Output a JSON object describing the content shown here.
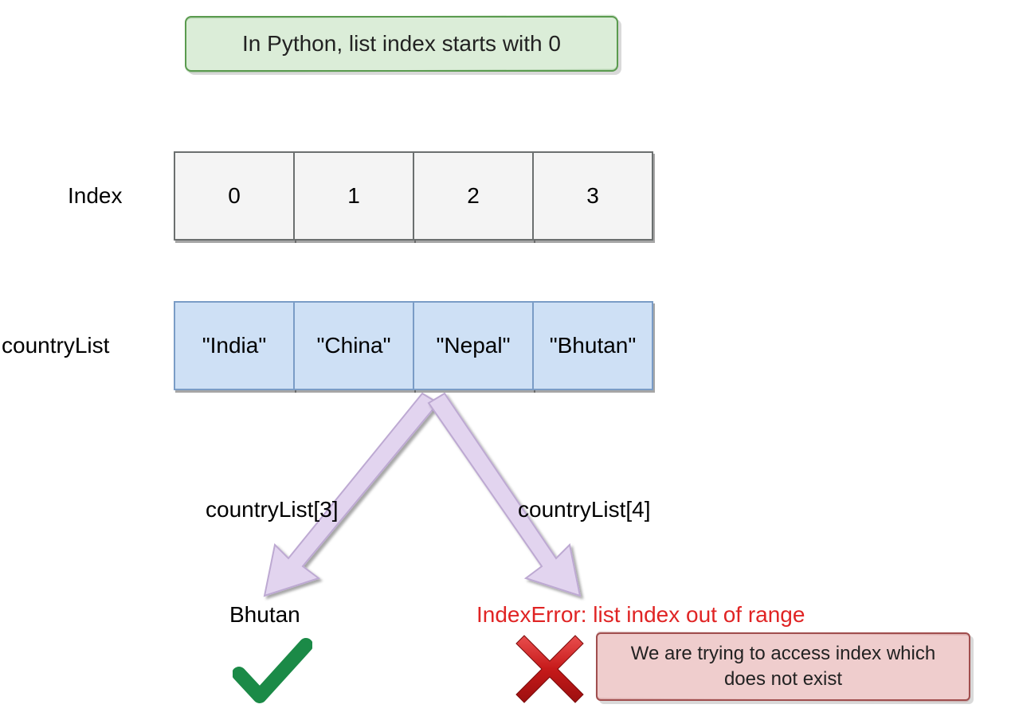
{
  "title": "In Python, list index starts with 0",
  "labels": {
    "index": "Index",
    "countryList": "countryList"
  },
  "indexCells": [
    "0",
    "1",
    "2",
    "3"
  ],
  "countryCells": [
    "\"India\"",
    "\"China\"",
    "\"Nepal\"",
    "\"Bhutan\""
  ],
  "access": {
    "leftCode": "countryList[3]",
    "leftResult": "Bhutan",
    "rightCode": "countryList[4]",
    "rightError": "IndexError: list index out of range",
    "rightExplanation": "We are trying to access index which does not exist"
  },
  "colors": {
    "titleBg": "#dbedd8",
    "titleBorder": "#5b9b4f",
    "greyBg": "#f4f4f4",
    "greyBorder": "#6b6f6f",
    "blueBg": "#cee0f5",
    "blueBorder": "#7a9cc6",
    "arrow": "#e2d4ef",
    "arrowStroke": "#bda9d2",
    "errorText": "#e02424",
    "errorBoxBg": "#efcdcd",
    "errorBoxBorder": "#a14e4e",
    "checkGreen": "#1b8a47",
    "crossRed": "#c61a1a"
  }
}
